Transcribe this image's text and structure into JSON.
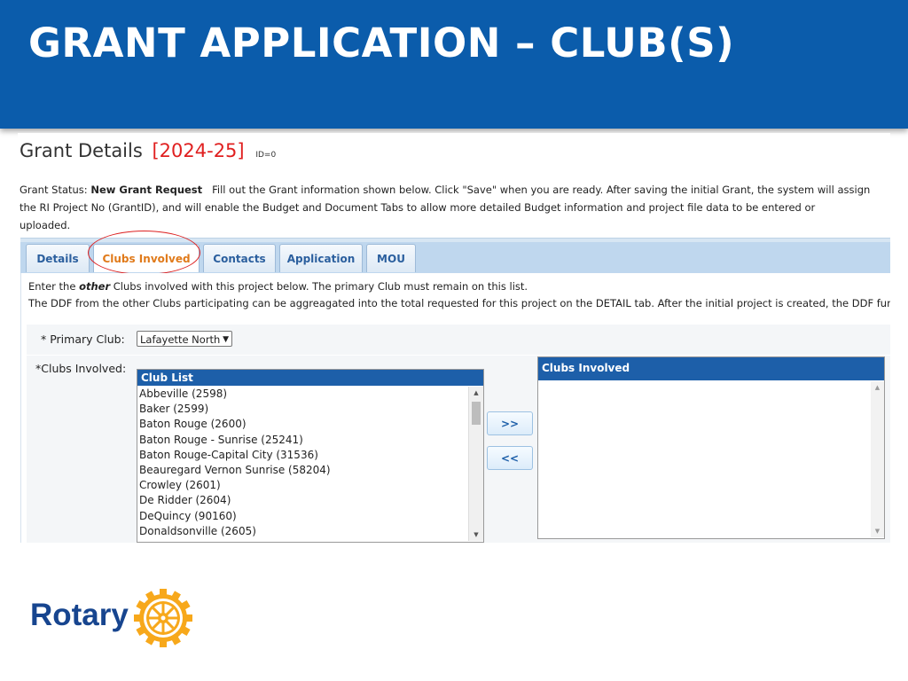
{
  "slide": {
    "title": "GRANT APPLICATION – CLUB(S)",
    "colors": {
      "title_bar": "#0b5cab",
      "accent_red": "#e02020",
      "tab_active_text": "#e07a1a",
      "list_header": "#1d5fa9",
      "rotary_blue": "#17458f",
      "rotary_gold": "#f7a81b"
    }
  },
  "grant": {
    "heading": "Grant Details",
    "year": "[2024-25]",
    "id_text": "ID=0",
    "status_label": "Grant Status:",
    "status_value": "New Grant Request",
    "status_message_line1": "Fill out the Grant information shown below. Click \"Save\" when you are ready. After saving the initial Grant, the system will assign",
    "status_message_line2": "the RI Project No (GrantID), and will enable the Budget and Document Tabs to allow more detailed Budget information and project file data to be entered or",
    "status_message_line3": "uploaded."
  },
  "tabs": [
    {
      "label": "Details",
      "active": false
    },
    {
      "label": "Clubs Involved",
      "active": true
    },
    {
      "label": "Contacts",
      "active": false
    },
    {
      "label": "Application",
      "active": false
    },
    {
      "label": "MOU",
      "active": false
    }
  ],
  "panel": {
    "instruction_pre": "Enter the ",
    "instruction_em": "other",
    "instruction_post": " Clubs involved with this project below. The primary Club must remain on this list.",
    "instruction_line2": "The DDF from the other Clubs participating can be aggreagated into the total requested for this project on the DETAIL tab. After the initial project is created, the DDF funding c"
  },
  "form": {
    "primary_club_label": "* Primary Club:",
    "primary_club_value": "Lafayette North",
    "clubs_involved_label": "*Clubs Involved:",
    "club_list_header": "Club List",
    "club_list": [
      "Abbeville (2598)",
      "Baker (2599)",
      "Baton Rouge (2600)",
      "Baton Rouge - Sunrise (25241)",
      "Baton Rouge-Capital City (31536)",
      "Beauregard Vernon Sunrise (58204)",
      "Crowley (2601)",
      "De Ridder (2604)",
      "DeQuincy (90160)",
      "Donaldsonville (2605)"
    ],
    "add_button": ">>",
    "remove_button": "<<",
    "involved_header": "Clubs Involved"
  },
  "logo": {
    "word": "Rotary",
    "icon": "rotary-wheel-icon"
  }
}
